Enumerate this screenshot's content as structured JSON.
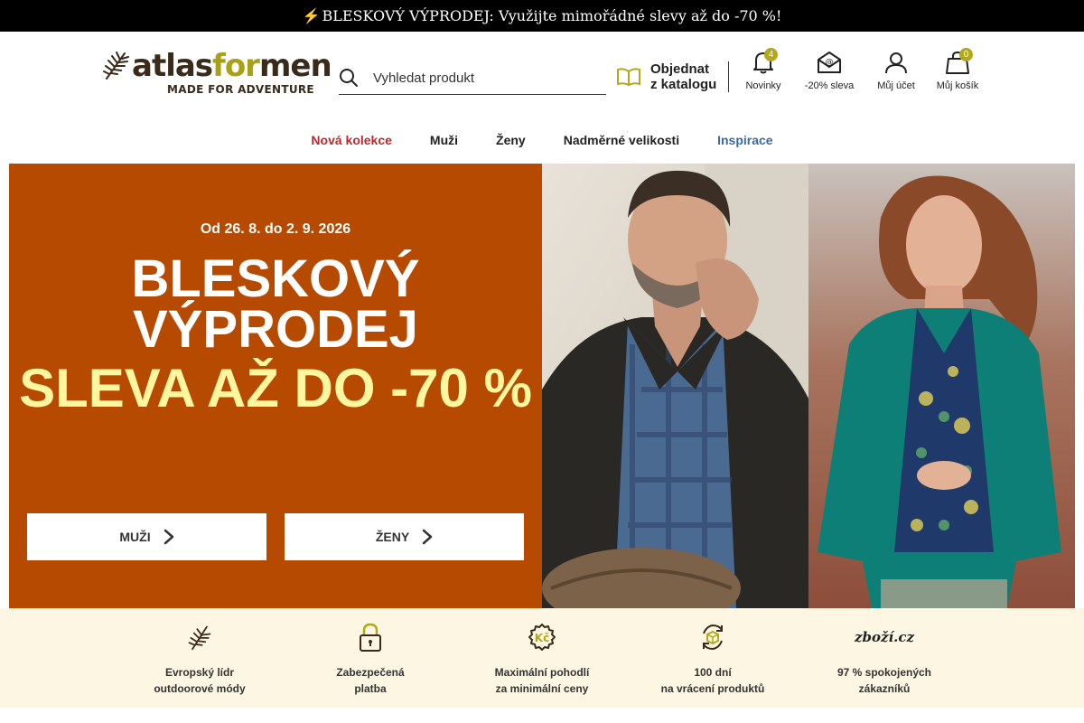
{
  "topbar": {
    "bolt": "⚡",
    "text": "BLESKOVÝ VÝPRODEJ: Využijte mimořádné slevy až do -70 %!"
  },
  "logo": {
    "part1": "atlas",
    "part2": "for",
    "part3": "men",
    "tagline": "MADE FOR ADVENTURE"
  },
  "search": {
    "placeholder": "Vyhledat produkt"
  },
  "catalog": {
    "line1": "Objednat",
    "line2": "z katalogu"
  },
  "header_icons": {
    "news": {
      "label": "Novinky",
      "badge": "4"
    },
    "discount": {
      "label": "-20% sleva"
    },
    "account": {
      "label": "Můj účet"
    },
    "cart": {
      "label": "Můj košík",
      "badge": "0"
    }
  },
  "nav": {
    "items": [
      {
        "label": "Nová kolekce"
      },
      {
        "label": "Muži"
      },
      {
        "label": "Ženy"
      },
      {
        "label": "Nadměrné velikosti"
      },
      {
        "label": "Inspirace"
      }
    ]
  },
  "hero": {
    "date": "Od 26. 8. do 2. 9. 2026",
    "title_line1": "BLESKOVÝ",
    "title_line2": "VÝPRODEJ",
    "subtitle": "SLEVA AŽ DO -70 %",
    "button_men": "MUŽI",
    "button_women": "ŽENY"
  },
  "benefits": [
    {
      "line1": "Evropský lídr",
      "line2": "outdoorové módy"
    },
    {
      "line1": "Zabezpečená",
      "line2": "platba"
    },
    {
      "line1": "Maximální pohodlí",
      "line2": "za minimální ceny"
    },
    {
      "line1": "100 dní",
      "line2": "na vrácení produktů"
    },
    {
      "line1": "97 % spokojených",
      "line2": "zákazníků"
    }
  ],
  "zbozi_logo": "zboží.cz",
  "colors": {
    "hero_bg": "#b54a00",
    "accent_yellow": "#fff7a0",
    "badge": "#b3a81a",
    "nav_red": "#c0272d",
    "nav_blue": "#3b6aa0",
    "benefits_bg": "#fdf6e3"
  }
}
